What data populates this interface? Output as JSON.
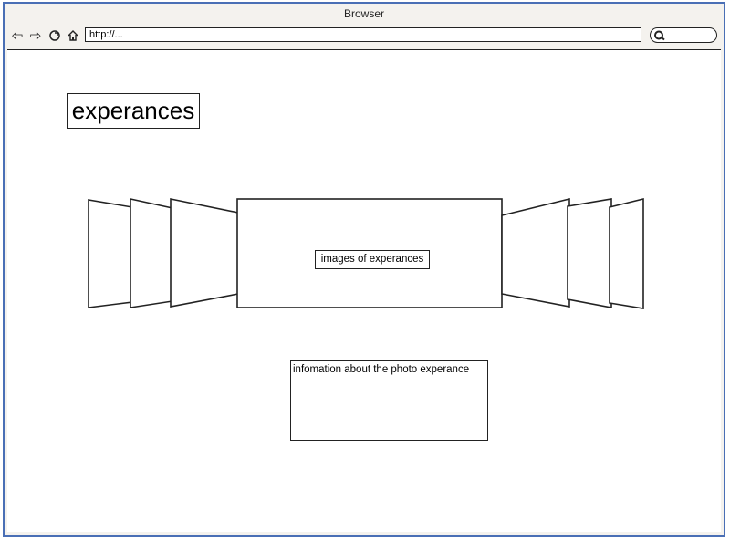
{
  "window": {
    "title": "Browser"
  },
  "toolbar": {
    "url": "http://...",
    "icons": [
      "back-icon",
      "forward-icon",
      "reload-icon",
      "home-icon",
      "search-icon"
    ]
  },
  "page": {
    "title": "experances",
    "carousel_label": "images of experances",
    "info_text": "infomation about the photo experance"
  },
  "colors": {
    "frame_border": "#4a6fb5",
    "chrome_bg": "#f4f2ee",
    "ink": "#222222"
  }
}
